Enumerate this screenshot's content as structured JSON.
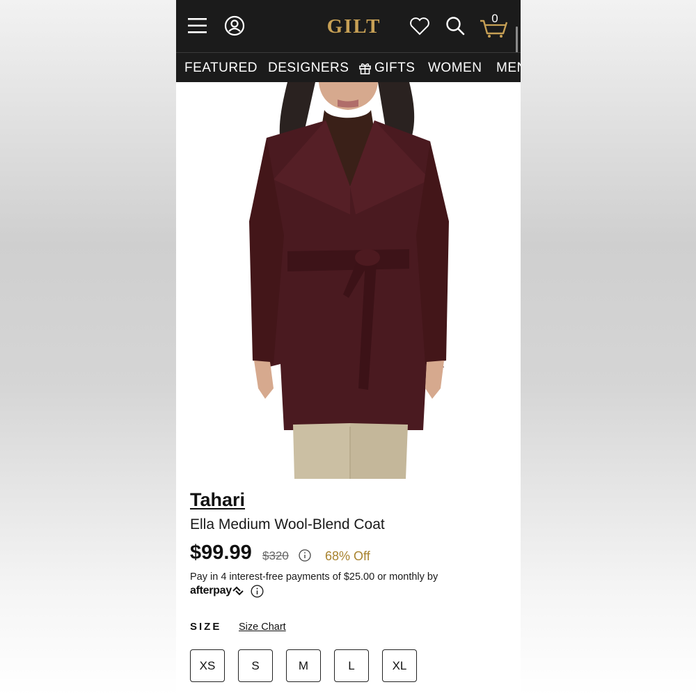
{
  "header": {
    "logo": "GILT",
    "cart_count": "0",
    "icons": [
      "menu-icon",
      "account-icon",
      "heart-icon",
      "search-icon",
      "cart-icon"
    ]
  },
  "nav": {
    "items": [
      {
        "label": "FEATURED"
      },
      {
        "label": "DESIGNERS"
      },
      {
        "label": "GIFTS",
        "icon": "gift-icon"
      },
      {
        "label": "WOMEN"
      },
      {
        "label": "MEN"
      }
    ]
  },
  "product": {
    "brand": "Tahari",
    "name": "Ella Medium Wool-Blend Coat",
    "price": "$99.99",
    "original_price": "$320",
    "discount": "68% Off",
    "afterpay_text": "Pay in 4 interest-free payments of $25.00 or monthly by",
    "afterpay_brand": "afterpay",
    "size_label": "SIZE",
    "size_chart_label": "Size Chart",
    "sizes": [
      "XS",
      "S",
      "M",
      "L",
      "XL"
    ]
  },
  "colors": {
    "header_bg": "#1b1b1b",
    "logo_gold": "#c7a055",
    "discount_gold": "#a8832f",
    "coat": "#4a1a20"
  }
}
